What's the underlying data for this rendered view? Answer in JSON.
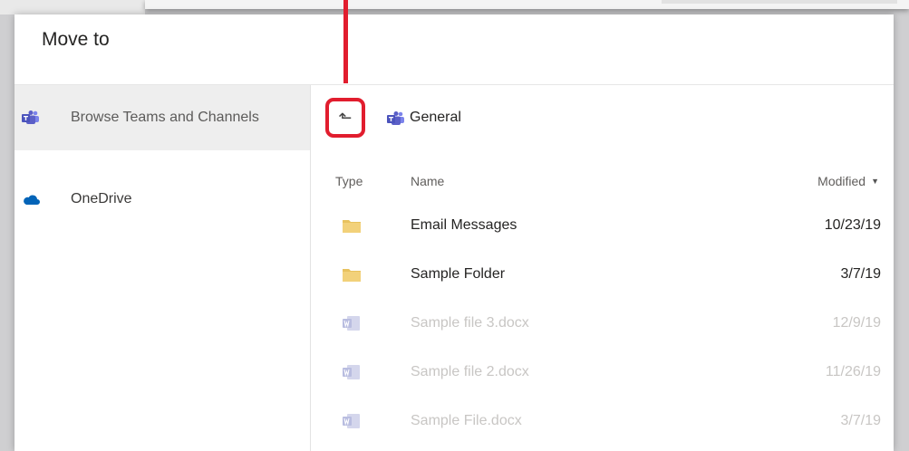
{
  "dialog": {
    "title": "Move to"
  },
  "sidebar": {
    "items": [
      {
        "label": "Browse Teams and Channels",
        "icon": "teams-icon",
        "selected": true
      },
      {
        "label": "OneDrive",
        "icon": "onedrive-cloud-icon",
        "selected": false
      }
    ]
  },
  "breadcrumb": {
    "up_icon": "up-arrow-icon",
    "current": "General",
    "current_icon": "teams-icon"
  },
  "table": {
    "headers": {
      "type": "Type",
      "name": "Name",
      "modified": "Modified"
    },
    "sort_icon": "sort-down-caret-icon",
    "rows": [
      {
        "type": "folder",
        "name": "Email Messages",
        "modified": "10/23/19",
        "enabled": true
      },
      {
        "type": "folder",
        "name": "Sample Folder",
        "modified": "3/7/19",
        "enabled": true
      },
      {
        "type": "word-doc",
        "name": "Sample file 3.docx",
        "modified": "12/9/19",
        "enabled": false
      },
      {
        "type": "word-doc",
        "name": "Sample file 2.docx",
        "modified": "11/26/19",
        "enabled": false
      },
      {
        "type": "word-doc",
        "name": "Sample File.docx",
        "modified": "3/7/19",
        "enabled": false
      }
    ]
  },
  "colors": {
    "highlight_red": "#e11d2e",
    "teams_purple": "#5b5fc7",
    "onedrive_blue": "#0364b8",
    "folder_yellow": "#e8c25e"
  }
}
